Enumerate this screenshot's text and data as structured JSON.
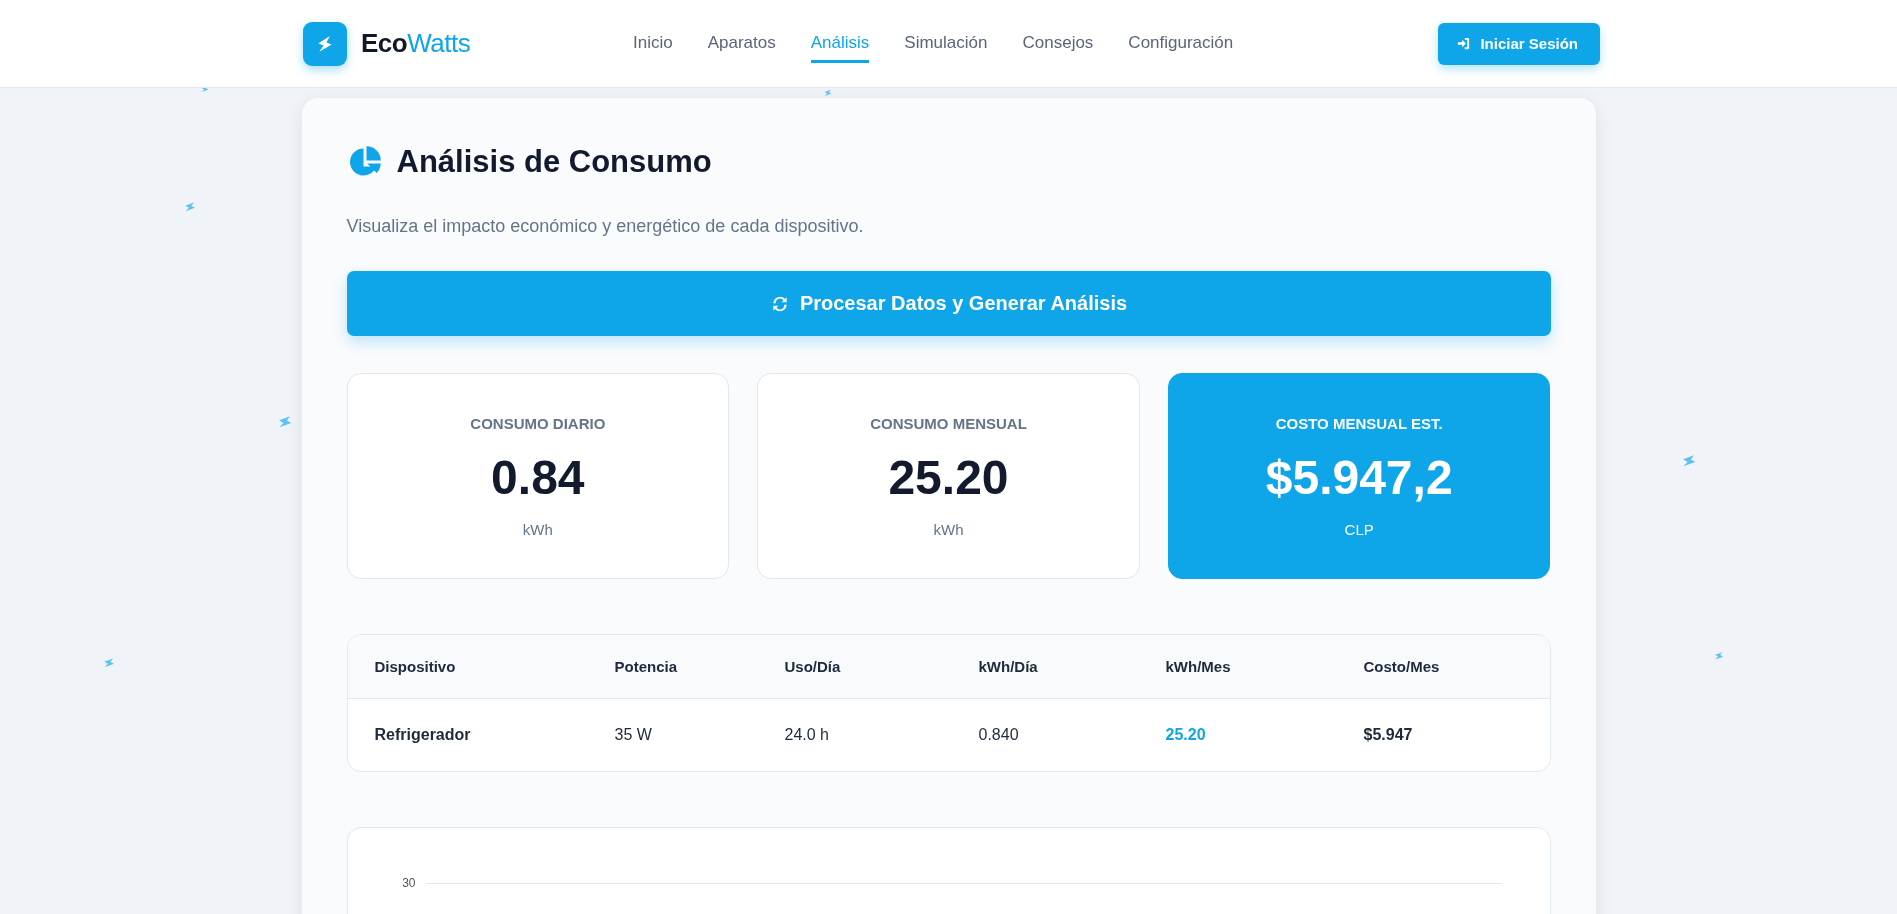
{
  "brand": {
    "name_part_1": "Eco",
    "name_part_2": "Watts"
  },
  "nav": [
    {
      "label": "Inicio",
      "selected": false
    },
    {
      "label": "Aparatos",
      "selected": false
    },
    {
      "label": "Análisis",
      "selected": true
    },
    {
      "label": "Simulación",
      "selected": false
    },
    {
      "label": "Consejos",
      "selected": false
    },
    {
      "label": "Configuración",
      "selected": false
    }
  ],
  "login_button": "Iniciar Sesión",
  "page": {
    "title": "Análisis de Consumo",
    "subtitle": "Visualiza el impacto económico y energético de cada dispositivo.",
    "process_button": "Procesar Datos y Generar Análisis",
    "stats": [
      {
        "label": "CONSUMO DIARIO",
        "value": "0.84",
        "unit": "kWh",
        "highlighted": false
      },
      {
        "label": "CONSUMO MENSUAL",
        "value": "25.20",
        "unit": "kWh",
        "highlighted": false
      },
      {
        "label": "COSTO MENSUAL EST.",
        "value": "$5.947,2",
        "unit": "CLP",
        "highlighted": true
      }
    ],
    "table": {
      "columns": [
        "Dispositivo",
        "Potencia",
        "Uso/Día",
        "kWh/Día",
        "kWh/Mes",
        "Costo/Mes"
      ],
      "rows": [
        {
          "cells": [
            {
              "text": "Refrigerador",
              "kind": "name"
            },
            {
              "text": "35 W",
              "kind": "plain"
            },
            {
              "text": "24.0 h",
              "kind": "plain"
            },
            {
              "text": "0.840",
              "kind": "plain"
            },
            {
              "text": "25.20",
              "kind": "highlight"
            },
            {
              "text": "$5.947",
              "kind": "strong"
            }
          ]
        }
      ]
    },
    "chart": {
      "tick_label": "30"
    }
  }
}
